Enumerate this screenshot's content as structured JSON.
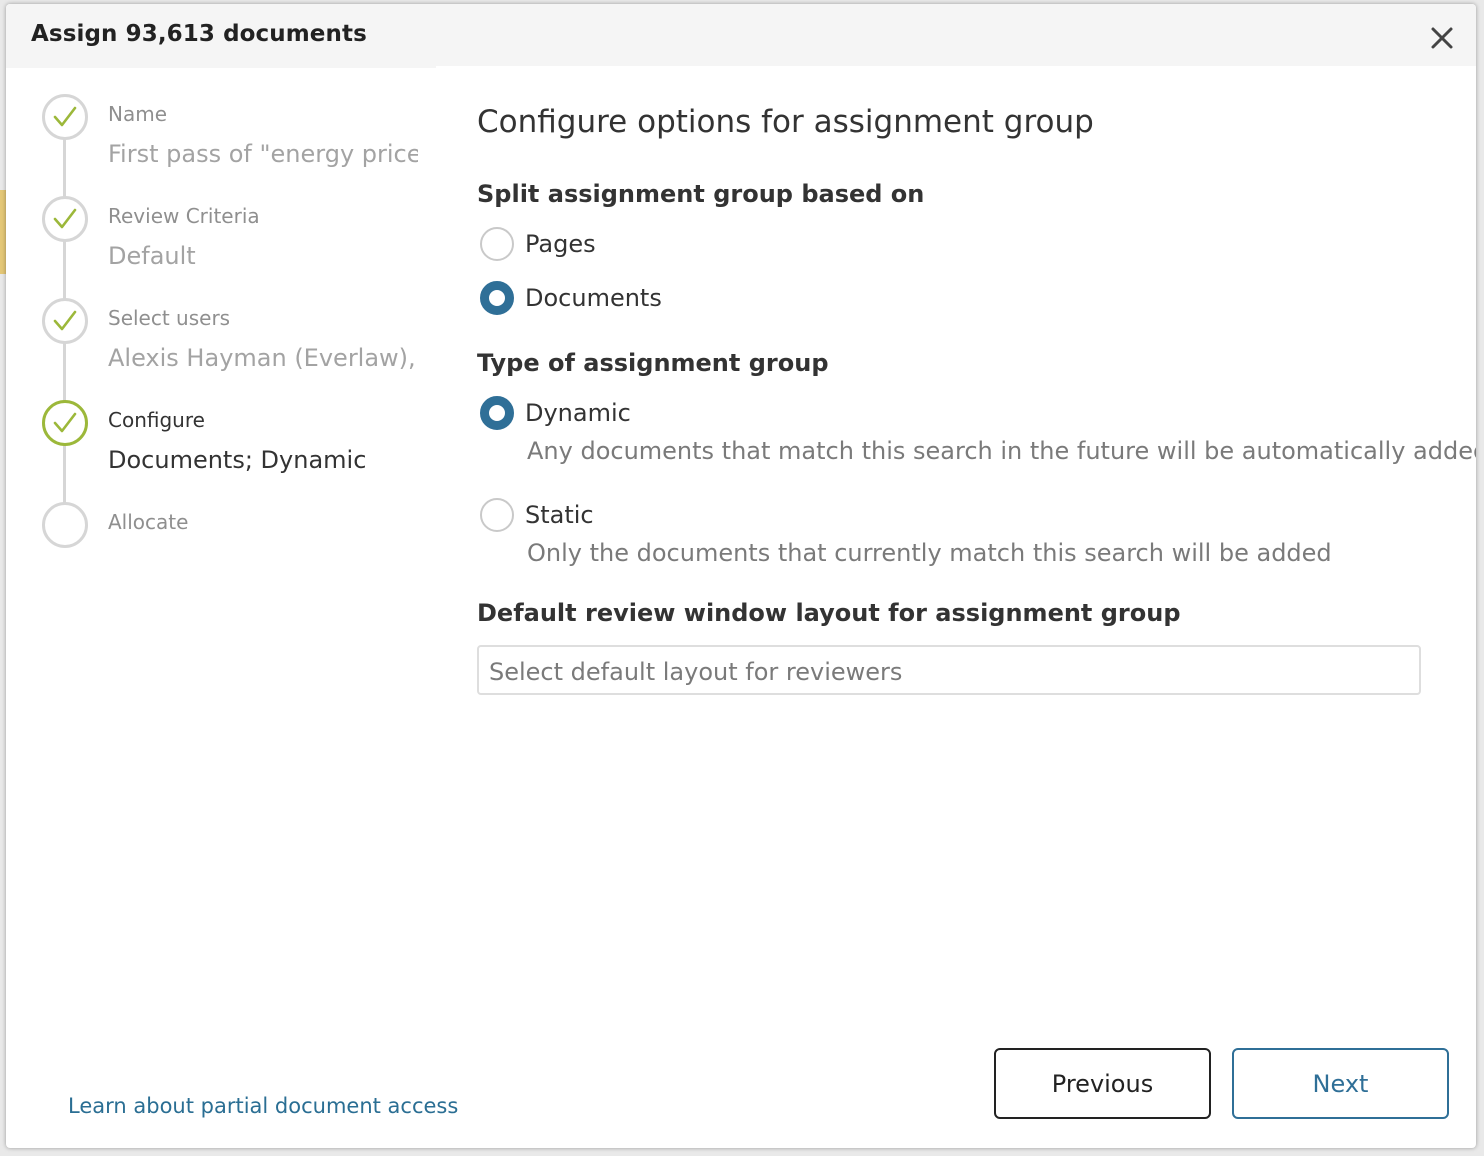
{
  "dialog": {
    "title": "Assign 93,613 documents"
  },
  "stepper": {
    "steps": [
      {
        "label": "Name",
        "value": "First pass of \"energy price...",
        "status": "complete"
      },
      {
        "label": "Review Criteria",
        "value": "Default",
        "status": "complete"
      },
      {
        "label": "Select users",
        "value": "Alexis Hayman (Everlaw), ...",
        "status": "complete"
      },
      {
        "label": "Configure",
        "value": "Documents; Dynamic",
        "status": "current"
      },
      {
        "label": "Allocate",
        "value": "",
        "status": "pending"
      }
    ]
  },
  "main": {
    "title": "Configure options for assignment group",
    "split": {
      "heading": "Split assignment group based on",
      "options": [
        {
          "label": "Pages",
          "checked": false
        },
        {
          "label": "Documents",
          "checked": true
        }
      ]
    },
    "type": {
      "heading": "Type of assignment group",
      "options": [
        {
          "label": "Dynamic",
          "description": "Any documents that match this search in the future will be automatically added",
          "checked": true
        },
        {
          "label": "Static",
          "description": "Only the documents that currently match this search will be added",
          "checked": false
        }
      ]
    },
    "layout": {
      "heading": "Default review window layout for assignment group",
      "placeholder": "Select default layout for reviewers"
    }
  },
  "footer": {
    "link": "Learn about partial document access",
    "previous_label": "Previous",
    "next_label": "Next"
  },
  "colors": {
    "accent": "#2f6f97",
    "check_green": "#9cb83a",
    "link": "#2a6e93"
  }
}
